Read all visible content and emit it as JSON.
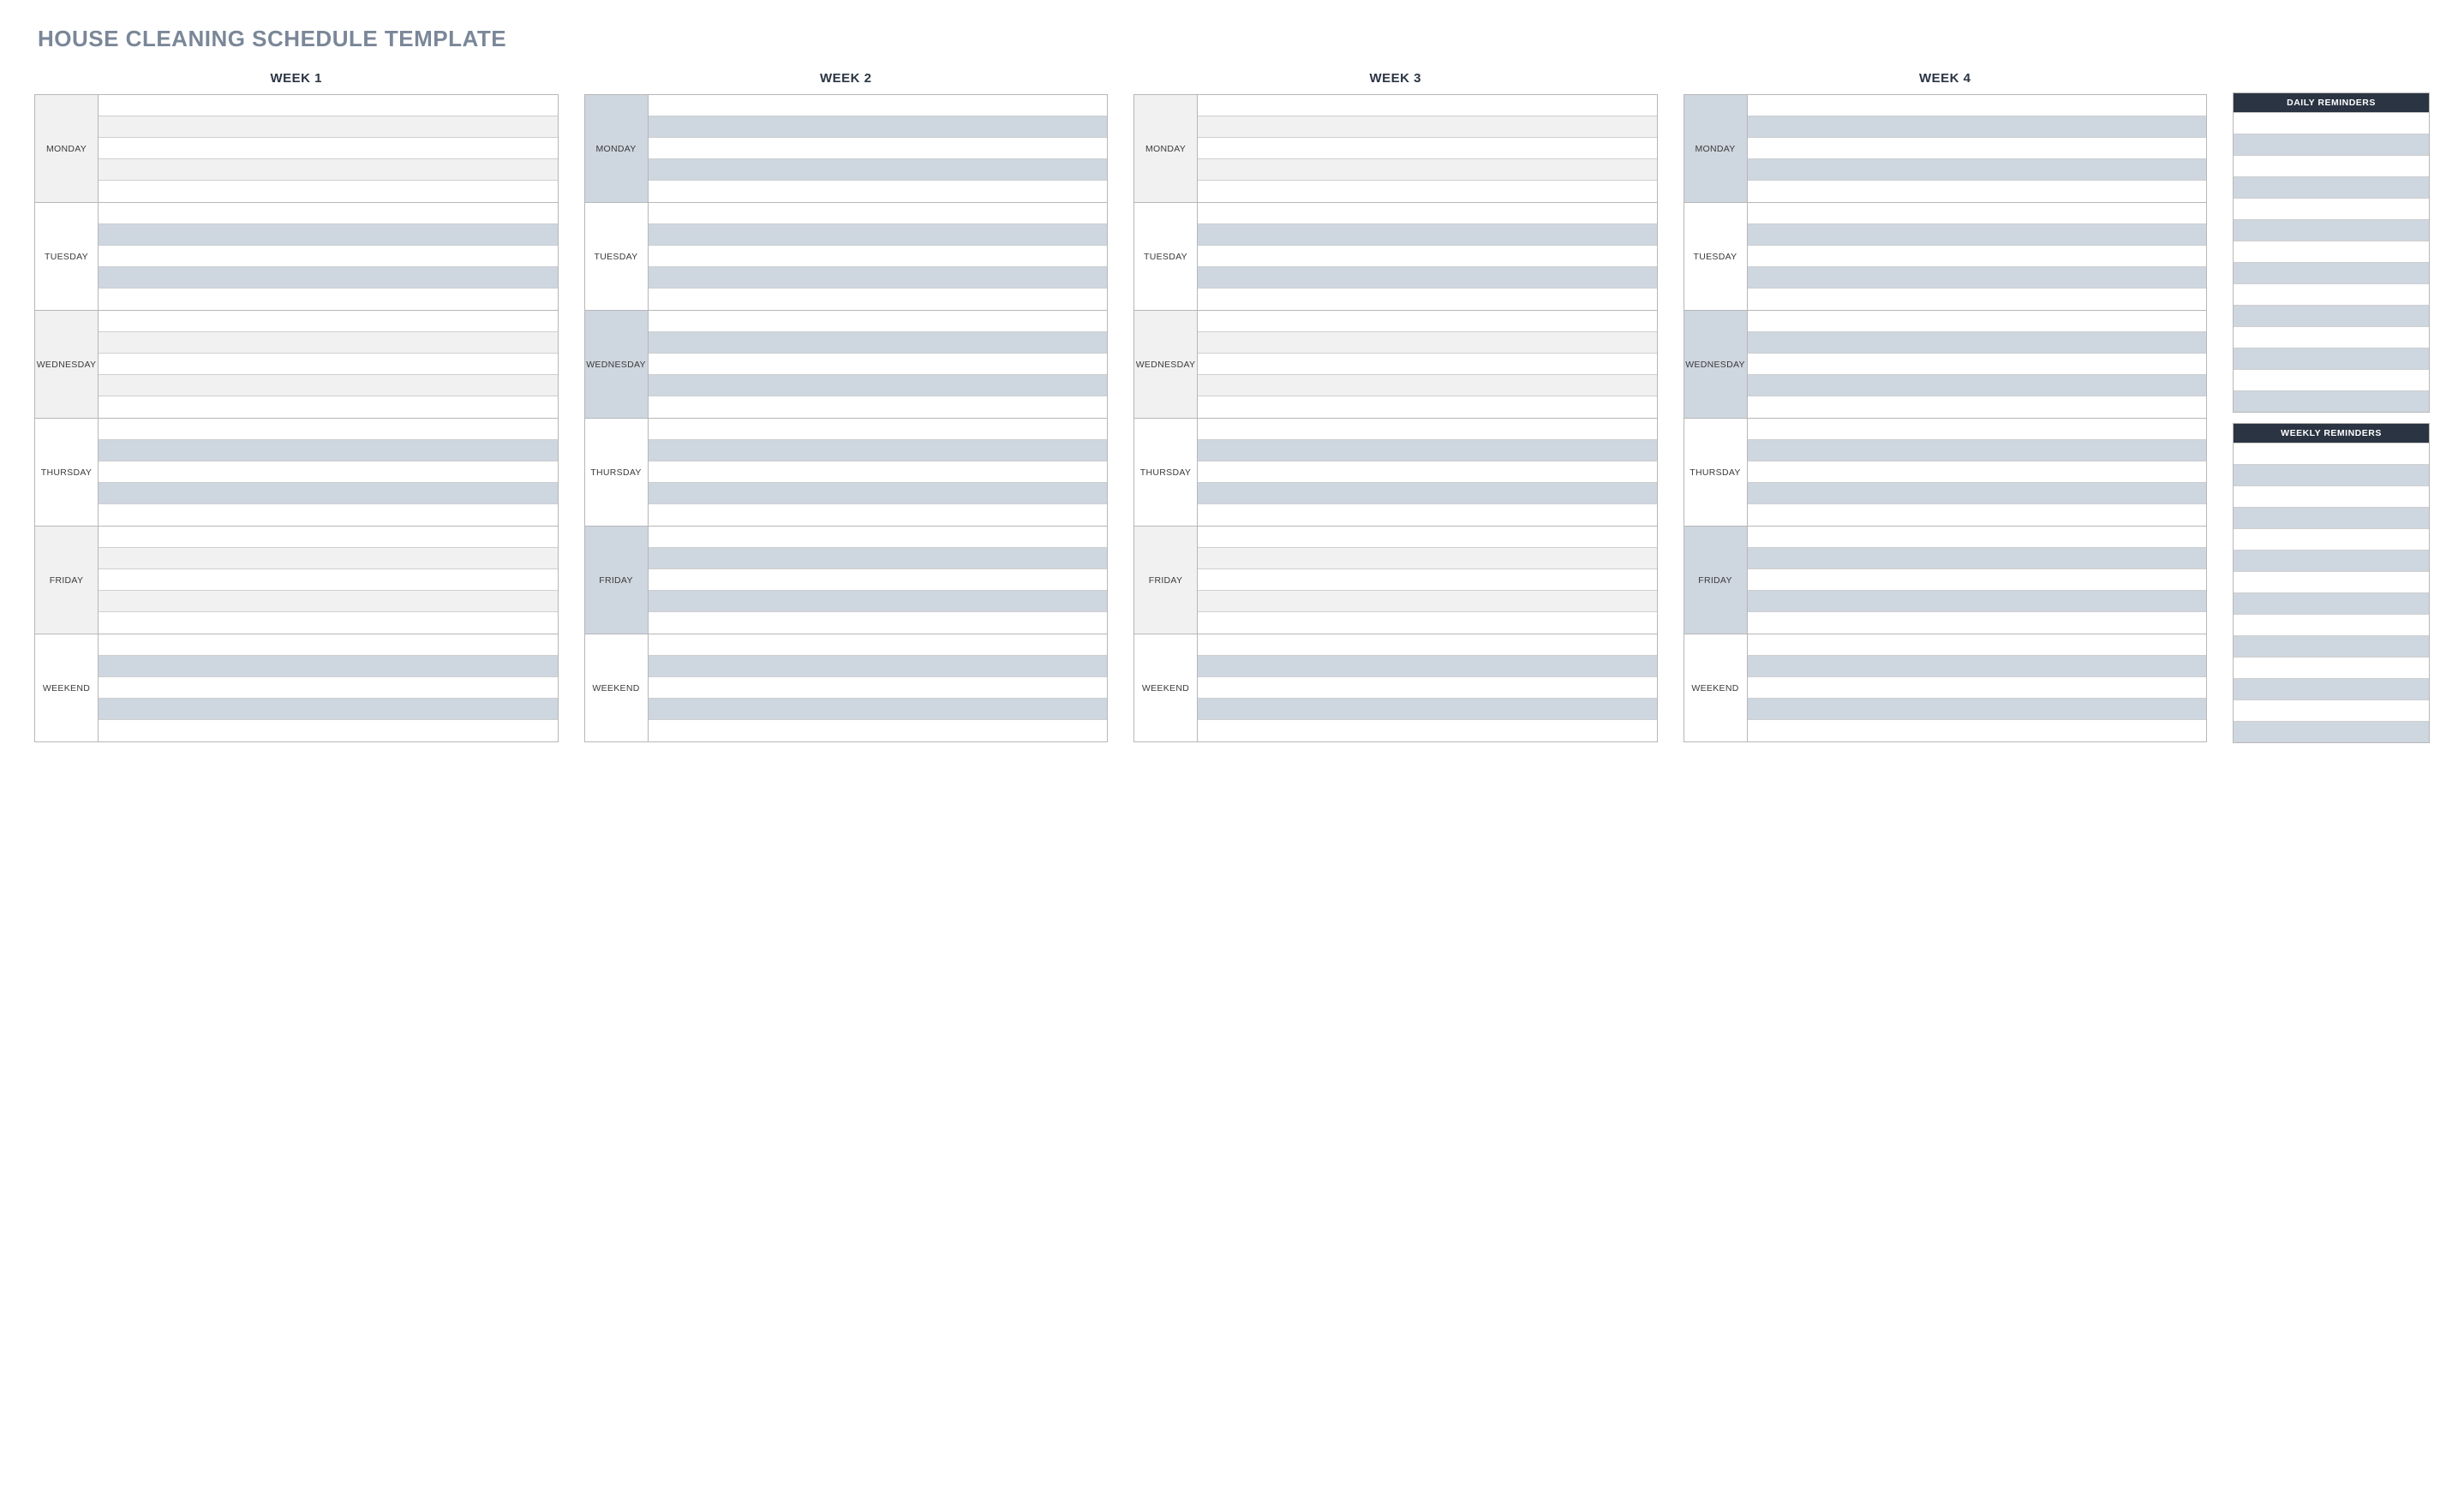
{
  "title": "HOUSE CLEANING SCHEDULE TEMPLATE",
  "weeks": [
    {
      "header": "WEEK 1"
    },
    {
      "header": "WEEK 2"
    },
    {
      "header": "WEEK 3"
    },
    {
      "header": "WEEK 4"
    }
  ],
  "days": [
    "MONDAY",
    "TUESDAY",
    "WEDNESDAY",
    "THURSDAY",
    "FRIDAY",
    "WEEKEND"
  ],
  "rows_per_day": 5,
  "side": {
    "daily": {
      "header": "DAILY REMINDERS",
      "rows": 14
    },
    "weekly": {
      "header": "WEEKLY REMINDERS",
      "rows": 14
    }
  },
  "colors": {
    "heading": "#7a8798",
    "grey": "#f1f1f1",
    "slate": "#ced6e0",
    "dark": "#2b3443",
    "line": "#b7b7b7"
  }
}
